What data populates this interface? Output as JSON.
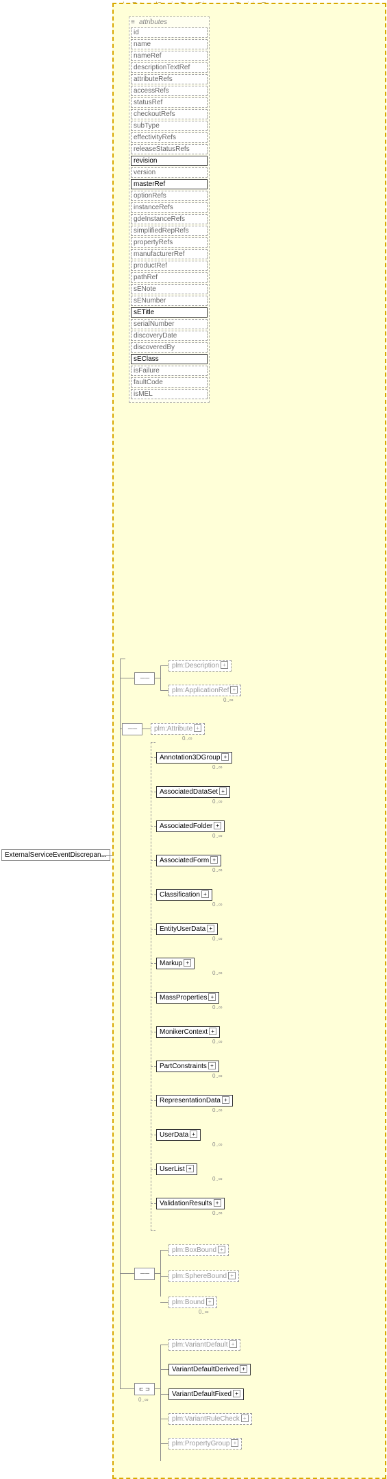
{
  "rootElement": "ExternalServiceEventDiscrepan...",
  "typeTitle": "plm:ExternalServiceEventDiscrepancyRevisionType",
  "attributesLabel": "attributes",
  "attributes": [
    {
      "name": "id",
      "style": "dashed"
    },
    {
      "name": "name",
      "style": "dashed"
    },
    {
      "name": "nameRef",
      "style": "dashed"
    },
    {
      "name": "descriptionTextRef",
      "style": "dashed"
    },
    {
      "name": "attributeRefs",
      "style": "dashed"
    },
    {
      "name": "accessRefs",
      "style": "dashed"
    },
    {
      "name": "statusRef",
      "style": "dashed"
    },
    {
      "name": "checkoutRefs",
      "style": "dashed"
    },
    {
      "name": "subType",
      "style": "dashed"
    },
    {
      "name": "effectivityRefs",
      "style": "dashed"
    },
    {
      "name": "releaseStatusRefs",
      "style": "dashed"
    },
    {
      "name": "revision",
      "style": "solid"
    },
    {
      "name": "version",
      "style": "dashed"
    },
    {
      "name": "masterRef",
      "style": "solid"
    },
    {
      "name": "optionRefs",
      "style": "dashed"
    },
    {
      "name": "instanceRefs",
      "style": "dashed"
    },
    {
      "name": "gdeInstanceRefs",
      "style": "dashed"
    },
    {
      "name": "simplifiedRepRefs",
      "style": "dashed"
    },
    {
      "name": "propertyRefs",
      "style": "dashed"
    },
    {
      "name": "manufacturerRef",
      "style": "dashed"
    },
    {
      "name": "productRef",
      "style": "dashed"
    },
    {
      "name": "pathRef",
      "style": "dashed"
    },
    {
      "name": "sENote",
      "style": "dashed"
    },
    {
      "name": "sENumber",
      "style": "dashed"
    },
    {
      "name": "sETitle",
      "style": "solid"
    },
    {
      "name": "serialNumber",
      "style": "dashed"
    },
    {
      "name": "discoveryDate",
      "style": "dashed"
    },
    {
      "name": "discoveredBy",
      "style": "dashed"
    },
    {
      "name": "sEClass",
      "style": "solid"
    },
    {
      "name": "isFailure",
      "style": "dashed"
    },
    {
      "name": "faultCode",
      "style": "dashed"
    },
    {
      "name": "isMEL",
      "style": "dashed"
    }
  ],
  "seq1": [
    {
      "label": "plm:Description",
      "style": "dashed",
      "expand": true,
      "mult": ""
    },
    {
      "label": "plm:ApplicationRef",
      "style": "dashed",
      "expand": true,
      "mult": "0..∞"
    }
  ],
  "attributeElem": {
    "label": "plm:Attribute",
    "style": "dashed",
    "expand": true,
    "mult": "0..∞"
  },
  "subGroup": [
    {
      "label": "Annotation3DGroup",
      "mult": "0..∞"
    },
    {
      "label": "AssociatedDataSet",
      "mult": "0..∞"
    },
    {
      "label": "AssociatedFolder",
      "mult": "0..∞"
    },
    {
      "label": "AssociatedForm",
      "mult": "0..∞"
    },
    {
      "label": "Classification",
      "mult": "0..∞"
    },
    {
      "label": "EntityUserData",
      "mult": "0..∞"
    },
    {
      "label": "Markup",
      "mult": "0..∞"
    },
    {
      "label": "MassProperties",
      "mult": "0..∞"
    },
    {
      "label": "MonikerContext",
      "mult": "0..∞"
    },
    {
      "label": "PartConstraints",
      "mult": "0..∞"
    },
    {
      "label": "RepresentationData",
      "mult": "0..∞"
    },
    {
      "label": "UserData",
      "mult": "0..∞"
    },
    {
      "label": "UserList",
      "mult": "0..∞"
    },
    {
      "label": "ValidationResults",
      "mult": "0..∞"
    }
  ],
  "boundGroup": [
    {
      "label": "plm:BoxBound",
      "style": "dashed"
    },
    {
      "label": "plm:SphereBound",
      "style": "dashed"
    },
    {
      "label": "plm:Bound",
      "style": "dashed",
      "mult": "0..∞"
    }
  ],
  "variantGroupMult": "0..∞",
  "variantGroup": [
    {
      "label": "plm:VariantDefault",
      "style": "dashed"
    },
    {
      "label": "VariantDefaultDerived",
      "style": "solid"
    },
    {
      "label": "VariantDefaultFixed",
      "style": "solid"
    },
    {
      "label": "plm:VariantRuleCheck",
      "style": "dashed"
    },
    {
      "label": "plm:PropertyGroup",
      "style": "dashed"
    }
  ]
}
